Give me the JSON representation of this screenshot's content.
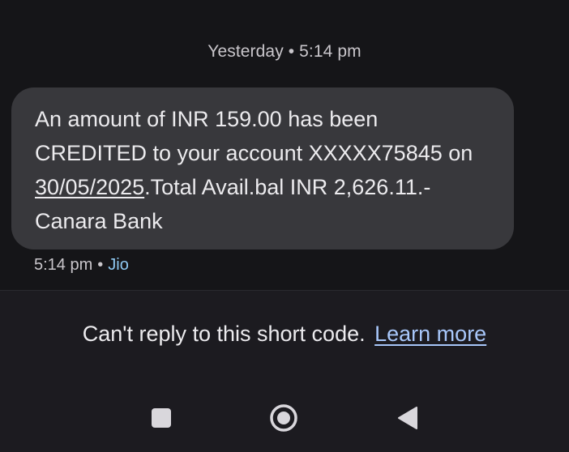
{
  "thread": {
    "timestamp_header": "Yesterday • 5:14 pm",
    "message": {
      "text_before_link": "An amount of INR 159.00 has been CREDITED to your account XXXXX75845 on ",
      "date_link": "30/05/2025",
      "text_after_link": ".Total Avail.bal INR 2,626.11.-Canara Bank",
      "time": "5:14 pm",
      "separator": "•",
      "carrier": "Jio"
    }
  },
  "footer": {
    "notice_text": "Can't reply to this short code.",
    "learn_more_label": "Learn more"
  },
  "navbar": {
    "recents_icon": "square-recents-icon",
    "home_icon": "circle-home-icon",
    "back_icon": "triangle-back-icon"
  },
  "colors": {
    "background": "#151518",
    "bubble": "#38383c",
    "footer": "#1c1b20",
    "link": "#a8c7fa",
    "carrier": "#8fc9f2"
  }
}
